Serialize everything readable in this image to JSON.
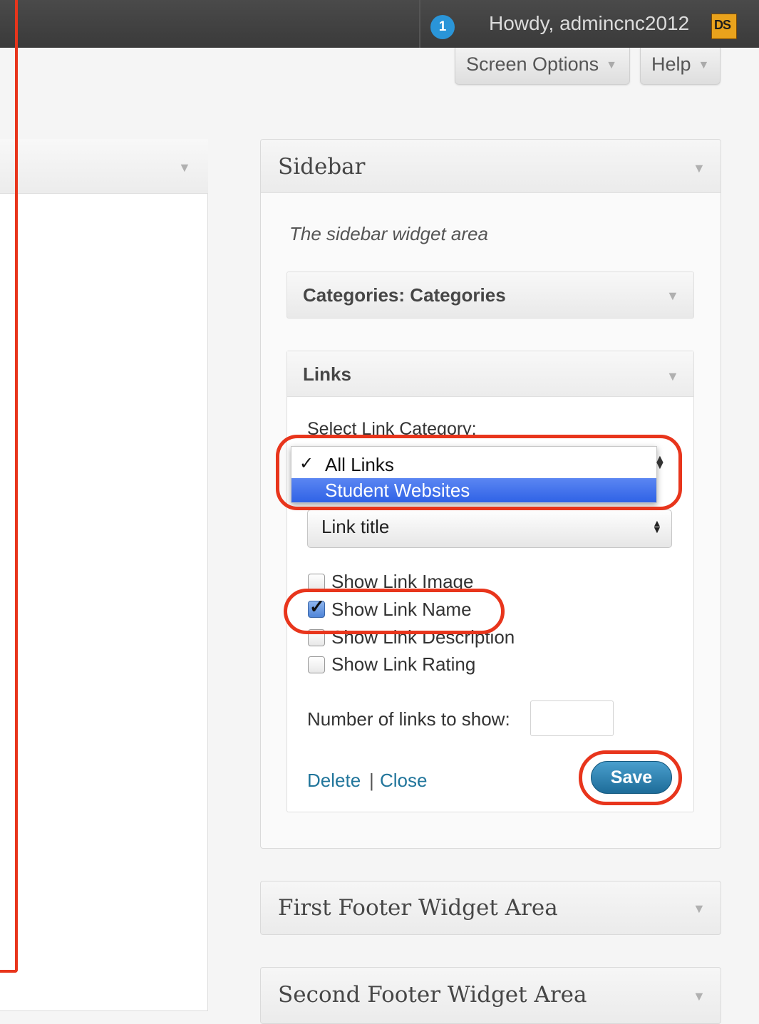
{
  "admin_bar": {
    "update_count": "1",
    "greeting": "Howdy, admincnc2012",
    "avatar_initials": "DS"
  },
  "screen_options": {
    "label": "Screen Options",
    "arrow": "▼"
  },
  "help": {
    "label": "Help",
    "arrow": "▼"
  },
  "sidebar": {
    "title": "Sidebar",
    "description": "The sidebar widget area",
    "widgets": {
      "categories": {
        "name": "Categories",
        "sep": ":",
        "title": " Categories"
      },
      "links": {
        "title": "Links",
        "select_category_label": "Select Link Category:",
        "category_options": [
          "All Links",
          "Student Websites"
        ],
        "selected_category": "All Links",
        "highlighted_option": "Student Websites",
        "sort_by_value": "Link title",
        "checkboxes": [
          {
            "label": "Show Link Image",
            "checked": false
          },
          {
            "label": "Show Link Name",
            "checked": true
          },
          {
            "label": "Show Link Description",
            "checked": false
          },
          {
            "label": "Show Link Rating",
            "checked": false
          }
        ],
        "number_label": "Number of links to show:",
        "number_value": "",
        "delete_label": "Delete",
        "separator": "|",
        "close_label": "Close",
        "save_label": "Save"
      }
    }
  },
  "footer_areas": [
    "First Footer Widget Area",
    "Second Footer Widget Area"
  ],
  "colors": {
    "admin_bar": "#3a3a3a",
    "link": "#21759b",
    "annotation": "#e8351c",
    "save_button": "#1e6c99"
  }
}
